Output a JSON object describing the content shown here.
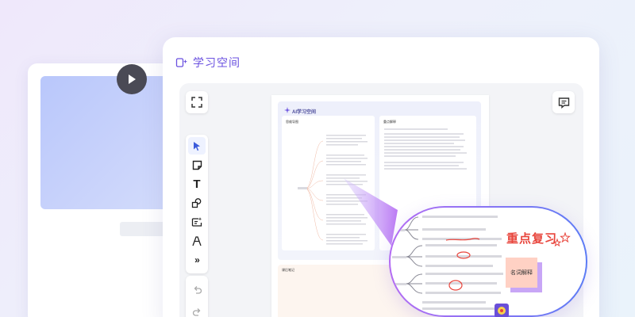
{
  "app": {
    "title": "学习空间",
    "icon": "ai-spark-icon",
    "accent_color": "#6b52e0"
  },
  "toolbar": {
    "tools": [
      {
        "name": "select",
        "icon": "cursor-icon",
        "active": true
      },
      {
        "name": "sticky-note",
        "icon": "sticky-note-icon"
      },
      {
        "name": "text",
        "icon": "text-icon",
        "label": "T"
      },
      {
        "name": "shapes",
        "icon": "shapes-icon"
      },
      {
        "name": "ai-note",
        "icon": "ai-note-icon"
      },
      {
        "name": "pen",
        "icon": "pen-icon"
      },
      {
        "name": "more",
        "icon": "chevrons-right-icon",
        "label": "»"
      }
    ],
    "history": [
      {
        "name": "undo",
        "icon": "undo-icon"
      },
      {
        "name": "redo",
        "icon": "redo-icon"
      }
    ]
  },
  "canvas_controls": {
    "fullscreen_icon": "fullscreen-icon",
    "comment_icon": "comment-icon"
  },
  "document": {
    "title": "AI学习空间",
    "mindmap_label": "思维导图",
    "explanation_label": "重点解释",
    "card2_label": "课后笔记"
  },
  "annotations": {
    "highlight_label": "重点复习",
    "highlight_color": "#e8453c",
    "sticky_note_label": "名词解释",
    "sticky_note_color": "#ffd1c4"
  }
}
